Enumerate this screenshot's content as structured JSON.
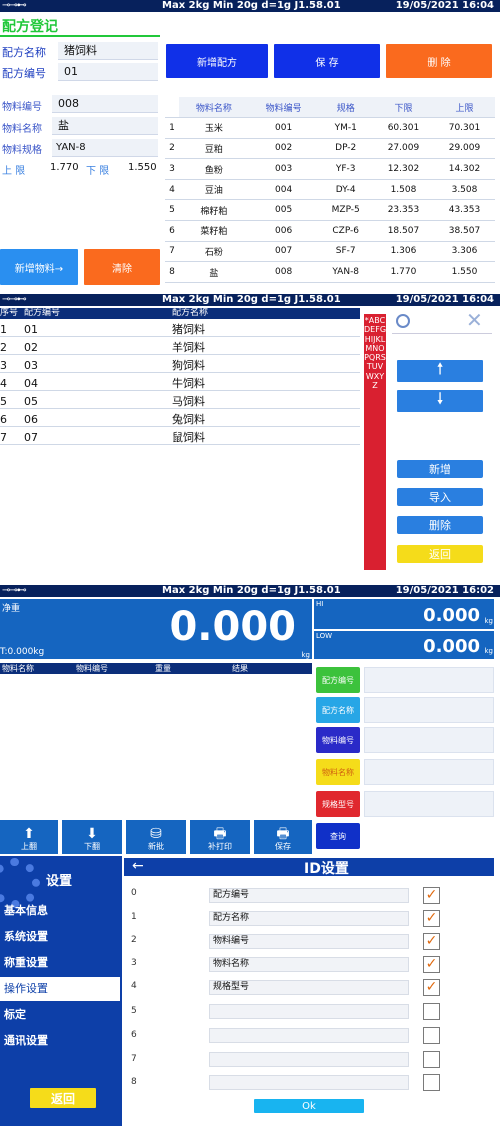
{
  "status_bar": {
    "icons": "⊸⊸⊷",
    "scale_info": "Max 2kg  Min 20g  d=1g   J1.58.01",
    "screen1_datetime": "19/05/2021  16:04",
    "screen2_datetime": "19/05/2021  16:04",
    "screen3_datetime": "19/05/2021  16:02"
  },
  "recipe_register": {
    "title": "配方登记",
    "recipe_name_label": "配方名称",
    "recipe_name_value": "猪饲料",
    "recipe_code_label": "配方编号",
    "recipe_code_value": "01",
    "material_code_label": "物料编号",
    "material_code_value": "008",
    "material_name_label": "物料名称",
    "material_name_value": "盐",
    "material_spec_label": "物料规格",
    "material_spec_value": "YAN-8",
    "upper_label": "上  限",
    "upper_value": "1.770",
    "lower_label": "下  限",
    "lower_value": "1.550",
    "new_recipe_btn": "新增配方",
    "save_btn": "保  存",
    "delete_btn": "删  除",
    "add_material_btn": "新增物料→",
    "clear_btn": "清除",
    "table_headers": [
      "物料名称",
      "物料编号",
      "规格",
      "下限",
      "上限"
    ],
    "table_rows": [
      [
        "1",
        "玉米",
        "001",
        "YM-1",
        "60.301",
        "70.301"
      ],
      [
        "2",
        "豆粕",
        "002",
        "DP-2",
        "27.009",
        "29.009"
      ],
      [
        "3",
        "鱼粉",
        "003",
        "YF-3",
        "12.302",
        "14.302"
      ],
      [
        "4",
        "豆油",
        "004",
        "DY-4",
        "1.508",
        "3.508"
      ],
      [
        "5",
        "棉籽粕",
        "005",
        "MZP-5",
        "23.353",
        "43.353"
      ],
      [
        "6",
        "菜籽粕",
        "006",
        "CZP-6",
        "18.507",
        "38.507"
      ],
      [
        "7",
        "石粉",
        "007",
        "SF-7",
        "1.306",
        "3.306"
      ],
      [
        "8",
        "盐",
        "008",
        "YAN-8",
        "1.770",
        "1.550"
      ]
    ]
  },
  "recipe_list": {
    "headers": [
      "序号",
      "配方编号",
      "配方名称"
    ],
    "rows": [
      [
        "1",
        "01",
        "猪饲料"
      ],
      [
        "2",
        "02",
        "羊饲料"
      ],
      [
        "3",
        "03",
        "狗饲料"
      ],
      [
        "4",
        "04",
        "牛饲料"
      ],
      [
        "5",
        "05",
        "马饲料"
      ],
      [
        "6",
        "06",
        "兔饲料"
      ],
      [
        "7",
        "07",
        "鼠饲料"
      ]
    ],
    "alphabet": "*ABCDEFGHIJKLMNOPQRSTUVWXYZ",
    "add_btn": "新增",
    "import_btn": "导入",
    "delete_btn": "删除",
    "back_btn": "返回"
  },
  "weighing": {
    "net_label": "净重",
    "weight_value": "0.000",
    "unit": "kg",
    "tare_label": "T:0.000kg",
    "hi_label": "HI",
    "hi_value": "0.000",
    "low_label": "LOW",
    "low_value": "0.000",
    "table_headers": [
      "物料名称",
      "物料编号",
      "重量",
      "结果"
    ],
    "side_buttons": [
      "配方编号",
      "配方名称",
      "物料编号",
      "物料名称",
      "规格型号",
      "查询"
    ],
    "bottom_buttons": [
      "上翻",
      "下翻",
      "新批",
      "补打印",
      "保存"
    ]
  },
  "id_settings": {
    "sidebar_title": "设置",
    "menu": [
      "基本信息",
      "系统设置",
      "称重设置",
      "操作设置",
      "标定",
      "通讯设置"
    ],
    "back_btn": "返回",
    "title": "ID设置",
    "back_arrow": "←",
    "rows": [
      {
        "index": "0",
        "value": "配方编号",
        "checked": "✓"
      },
      {
        "index": "1",
        "value": "配方名称",
        "checked": "✓"
      },
      {
        "index": "2",
        "value": "物料编号",
        "checked": "✓"
      },
      {
        "index": "3",
        "value": "物料名称",
        "checked": "✓"
      },
      {
        "index": "4",
        "value": "规格型号",
        "checked": "✓"
      },
      {
        "index": "5",
        "value": "",
        "checked": ""
      },
      {
        "index": "6",
        "value": "",
        "checked": ""
      },
      {
        "index": "7",
        "value": "",
        "checked": ""
      },
      {
        "index": "8",
        "value": "",
        "checked": ""
      }
    ],
    "ok_btn": "Ok"
  },
  "colors": {
    "status_bar": "#07215c",
    "title_green": "#21c83a",
    "blue_btn": "#1030e8",
    "orange_btn": "#fa6a1e",
    "sky_btn": "#2a8ff0",
    "red_alpha": "#d92030",
    "yellow": "#f5dc1a",
    "check": "#e06a10"
  }
}
